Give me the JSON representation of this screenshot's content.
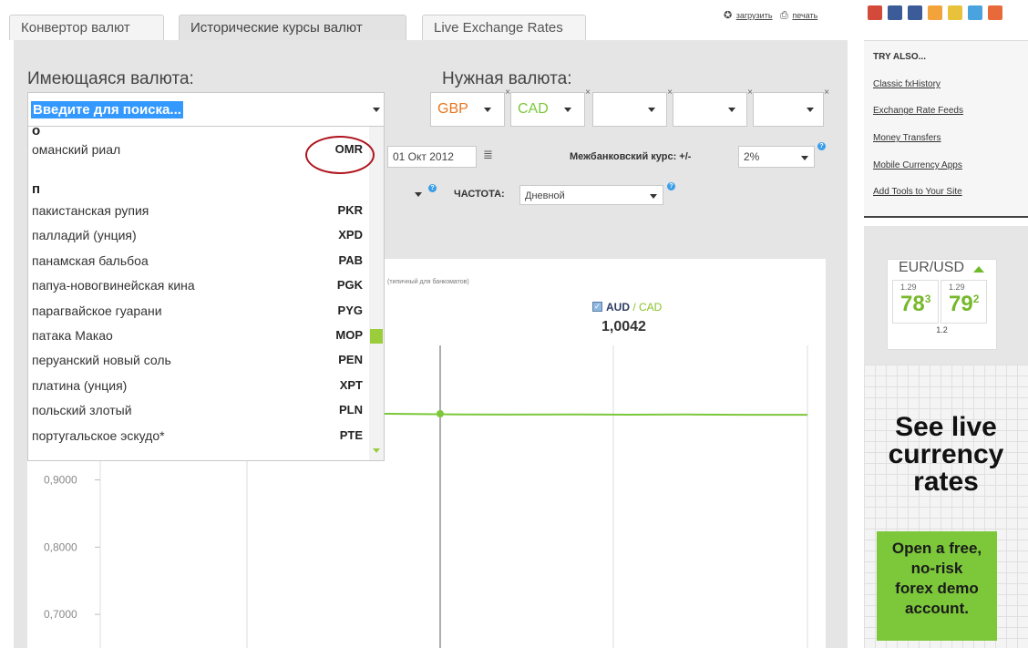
{
  "tabs": [
    {
      "label": "Конвертор валют"
    },
    {
      "label": "Исторические курсы валют"
    },
    {
      "label": "Live Exchange Rates"
    }
  ],
  "toplinks": {
    "download": "загрузить",
    "print": "печать"
  },
  "have": {
    "label": "Имеющаяся валюта:",
    "placeholder": "Введите для поиска..."
  },
  "need": {
    "label": "Нужная валюта:",
    "slots": [
      "GBP",
      "CAD",
      "",
      "",
      ""
    ],
    "colors": [
      "#e8761f",
      "#7cc83a"
    ]
  },
  "controls": {
    "date": "01 Окт 2012",
    "interbank_label": "Межбанковский курс: +/-",
    "interbank_value": "2%",
    "frequency_label": "ЧАСТОТА:",
    "frequency_value": "Дневной"
  },
  "dropdown": {
    "section_top": "о",
    "item_top": {
      "name": "оманский риал",
      "code": "OMR"
    },
    "section_p": "п",
    "items": [
      {
        "name": "пакистанская рупия",
        "code": "PKR"
      },
      {
        "name": "палладий (унция)",
        "code": "XPD"
      },
      {
        "name": "панамская бальбоа",
        "code": "PAB"
      },
      {
        "name": "папуа-новогвинейская кина",
        "code": "PGK"
      },
      {
        "name": "парагвайское гуарани",
        "code": "PYG"
      },
      {
        "name": "патака Макао",
        "code": "MOP"
      },
      {
        "name": "перуанский новый соль",
        "code": "PEN"
      },
      {
        "name": "платина (унция)",
        "code": "XPT"
      },
      {
        "name": "польский злотый",
        "code": "PLN"
      },
      {
        "name": "португальское эскудо*",
        "code": "PTE"
      }
    ]
  },
  "chart": {
    "note": "(типичный для банкоматов)",
    "legend_base": "AUD",
    "legend_sep": " / ",
    "legend_quote": "CAD",
    "legend_value": "1,0042",
    "series_color": "#7cc83a"
  },
  "chart_data": {
    "type": "line",
    "series": [
      {
        "name": "AUD / CAD",
        "y": [
          1.0042,
          1.0045,
          1.005,
          1.0055,
          1.0048,
          1.0045,
          1.0047,
          1.0044,
          1.0046,
          1.0043,
          1.0042
        ]
      }
    ],
    "yticks": [
      "0,9000",
      "0,8000",
      "0,7000"
    ],
    "grid": true
  },
  "sidebar": {
    "share_colors": [
      "#d44a3a",
      "#3b5b99",
      "#3b5b99",
      "#f2a33a",
      "#e8c23a",
      "#4aa3df",
      "#e86a3a"
    ],
    "tryalso_title": "TRY ALSO...",
    "tryalso_links": [
      "Classic fxHistory",
      "Exchange Rate Feeds",
      "Money Transfers",
      "Mobile Currency Apps",
      "Add Tools to Your Site"
    ],
    "widget": {
      "pair": "EUR/USD",
      "bid_small": "1.29",
      "bid_big": "78",
      "bid_sup": "3",
      "ask_small": "1.29",
      "ask_big": "79",
      "ask_sup": "2",
      "spread": "1.2"
    },
    "see_live": [
      "See live",
      "currency",
      "rates"
    ],
    "demo": [
      "Open a free,",
      "no-risk",
      "forex demo",
      "account."
    ]
  }
}
